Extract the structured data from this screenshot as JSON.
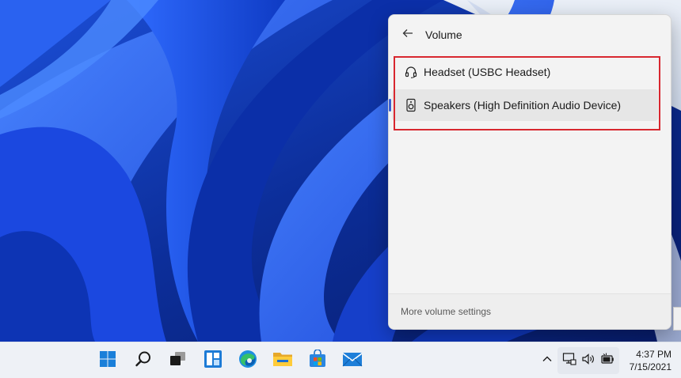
{
  "flyout": {
    "title": "Volume",
    "back_icon": "arrow-left-icon",
    "devices": [
      {
        "label": "Headset (USBC Headset)",
        "icon": "headset-icon",
        "selected": false
      },
      {
        "label": "Speakers (High Definition Audio Device)",
        "icon": "speaker-icon",
        "selected": true
      }
    ],
    "footer_link": "More volume settings",
    "highlight_color": "#d8272f"
  },
  "taskbar": {
    "apps": [
      {
        "name": "start-button",
        "icon": "windows-logo-icon"
      },
      {
        "name": "search-button",
        "icon": "search-icon"
      },
      {
        "name": "task-view-button",
        "icon": "task-view-icon"
      },
      {
        "name": "widgets-button",
        "icon": "widgets-icon"
      },
      {
        "name": "edge-button",
        "icon": "edge-icon"
      },
      {
        "name": "file-explorer-button",
        "icon": "folder-icon"
      },
      {
        "name": "store-button",
        "icon": "store-icon"
      },
      {
        "name": "mail-button",
        "icon": "mail-icon"
      }
    ],
    "tray": {
      "chevron_icon": "chevron-up-icon",
      "network_icon": "network-icon",
      "volume_icon": "volume-icon",
      "battery_icon": "battery-icon"
    },
    "clock": {
      "time": "4:37 PM",
      "date": "7/15/2021"
    }
  },
  "colors": {
    "accent": "#3a5fd1",
    "taskbar_bg": "#eef1f6",
    "flyout_bg": "#f3f3f3"
  }
}
